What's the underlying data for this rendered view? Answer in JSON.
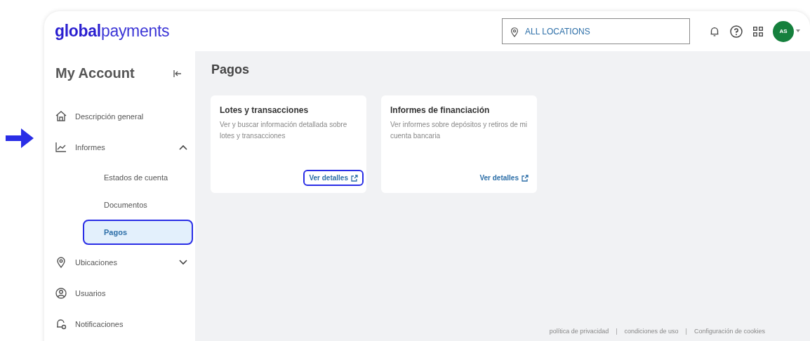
{
  "header": {
    "logo": "**global**payments",
    "location_field": {
      "value": "ALL LOCATIONS"
    },
    "avatar": "AS"
  },
  "sidebar": {
    "title": "My Account",
    "items": [
      {
        "label": "Descripción general",
        "kind": "link"
      },
      {
        "label": "Informes",
        "kind": "group",
        "expanded": true,
        "children": [
          {
            "label": "Estados de cuenta",
            "selected": false,
            "highlighted": false
          },
          {
            "label": "Documentos",
            "selected": false,
            "highlighted": false
          },
          {
            "label": "Pagos",
            "selected": true,
            "highlighted": true
          }
        ]
      },
      {
        "label": "Ubicaciones",
        "kind": "group",
        "expanded": false
      },
      {
        "label": "Usuarios",
        "kind": "link"
      },
      {
        "label": "Notificaciones",
        "kind": "link"
      }
    ]
  },
  "page": {
    "title": "Pagos",
    "cards": [
      {
        "title": "Lotes y transacciones",
        "description": "Ver y buscar información detallada sobre lotes y transacciones",
        "link": "Ver detalles",
        "highlighted": true
      },
      {
        "title": "Informes de financiación",
        "description": "Ver informes sobre depósitos y retiros de mi cuenta bancaria",
        "link": "Ver detalles",
        "highlighted": false
      }
    ]
  },
  "footer": [
    {
      "kind": "link",
      "text": "política de privacidad"
    },
    {
      "kind": "separator",
      "text": "|"
    },
    {
      "kind": "link",
      "text": "condiciones de uso"
    },
    {
      "kind": "separator",
      "text": "|"
    },
    {
      "kind": "link",
      "text": "Configuración de cookies"
    }
  ]
}
